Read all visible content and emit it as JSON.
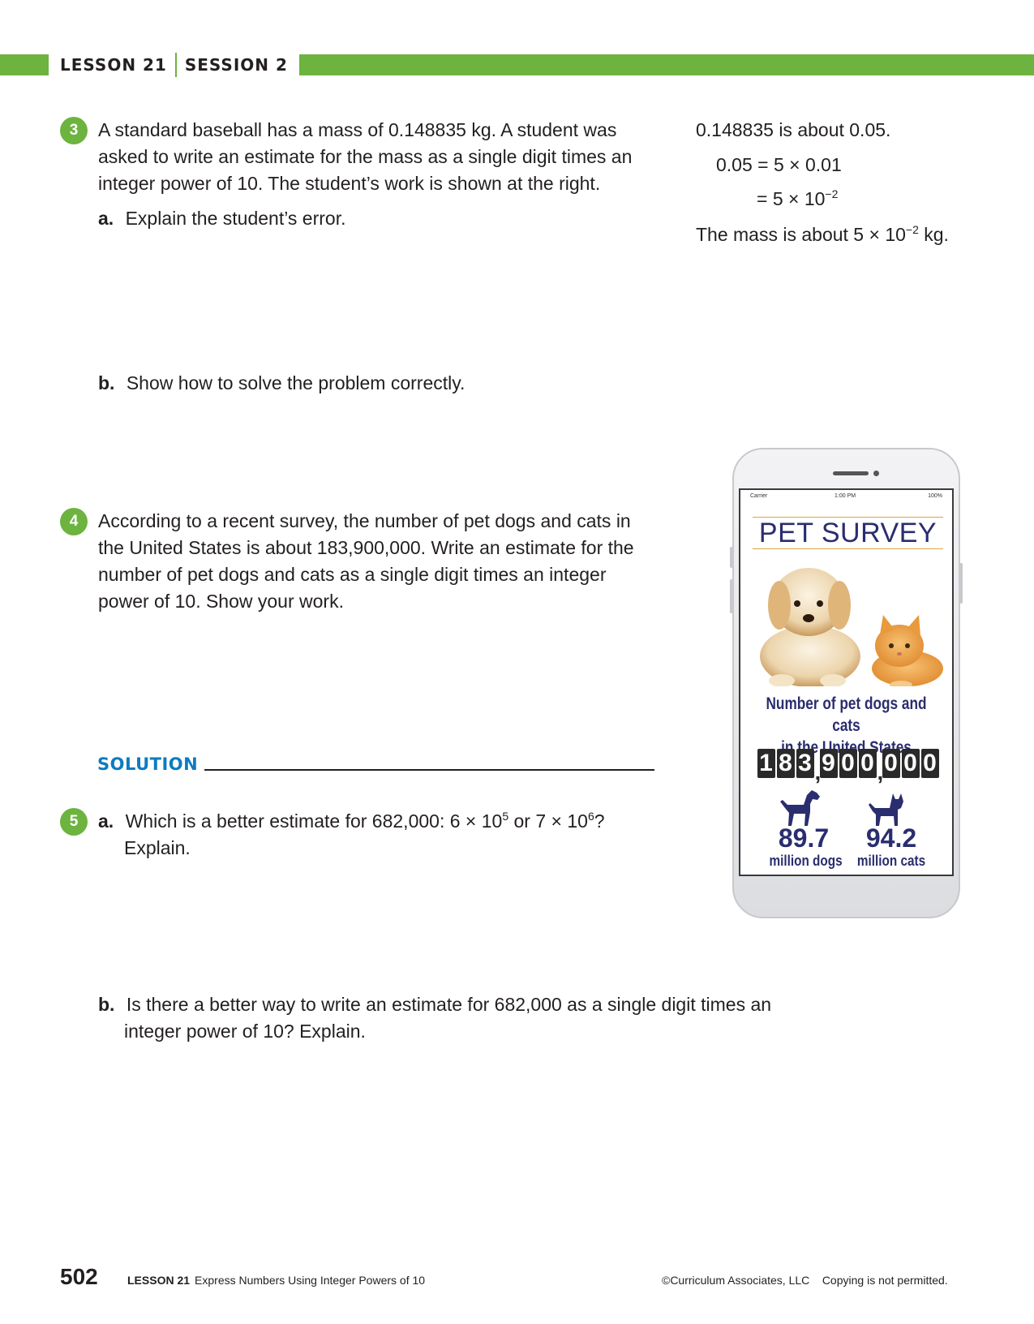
{
  "header": {
    "lesson": "LESSON 21",
    "session": "SESSION 2"
  },
  "q3": {
    "number": "3",
    "prompt_lines": [
      "A standard baseball has a mass of 0.148835 kg. A student was",
      "asked to write an estimate for the mass as a single digit times an",
      "integer power of 10. The student’s work is shown at the right."
    ],
    "a_label": "a.",
    "a_text": "Explain the student’s error.",
    "b_label": "b.",
    "b_text": "Show how to solve the problem correctly.",
    "work": {
      "line1": "0.148835 is about 0.05.",
      "line2": "0.05 = 5 × 0.01",
      "line3_base": "= 5 × 10",
      "line3_exp": "−2",
      "line4_pre": "The mass is about 5 × 10",
      "line4_exp": "−2",
      "line4_post": " kg."
    }
  },
  "q4": {
    "number": "4",
    "prompt_lines": [
      "According to a recent survey, the number of pet dogs and cats in",
      "the United States is about 183,900,000. Write an estimate for the",
      "number of pet dogs and cats as a single digit times an integer",
      "power of 10. Show your work."
    ],
    "solution_label": "SOLUTION"
  },
  "q5": {
    "number": "5",
    "a_label": "a.",
    "a_text_pre": "Which is a better estimate for 682,000: 6 × 10",
    "a_exp1": "5",
    "a_text_mid": " or 7 × 10",
    "a_exp2": "6",
    "a_text_post": "?",
    "a_line2": "Explain.",
    "b_label": "b.",
    "b_line1": "Is there a better way to write an estimate for 682,000 as a single digit times an",
    "b_line2": "integer power of 10? Explain."
  },
  "phone": {
    "status_left": "Carrier",
    "status_center": "1:00 PM",
    "status_right": "100%",
    "title": "PET SURVEY",
    "caption_line1": "Number of pet dogs and cats",
    "caption_line2": "in the United States",
    "counter_groups": [
      [
        "1",
        "8",
        "3"
      ],
      [
        "9",
        "0",
        "0"
      ],
      [
        "0",
        "0",
        "0"
      ]
    ],
    "dogs_value": "89.7",
    "dogs_unit": "million dogs",
    "cats_value": "94.2",
    "cats_unit": "million cats"
  },
  "footer": {
    "page_number": "502",
    "lesson": "LESSON 21",
    "lesson_title": "Express Numbers Using Integer Powers of 10",
    "copyright": "©Curriculum Associates, LLC    Copying is not permitted."
  }
}
